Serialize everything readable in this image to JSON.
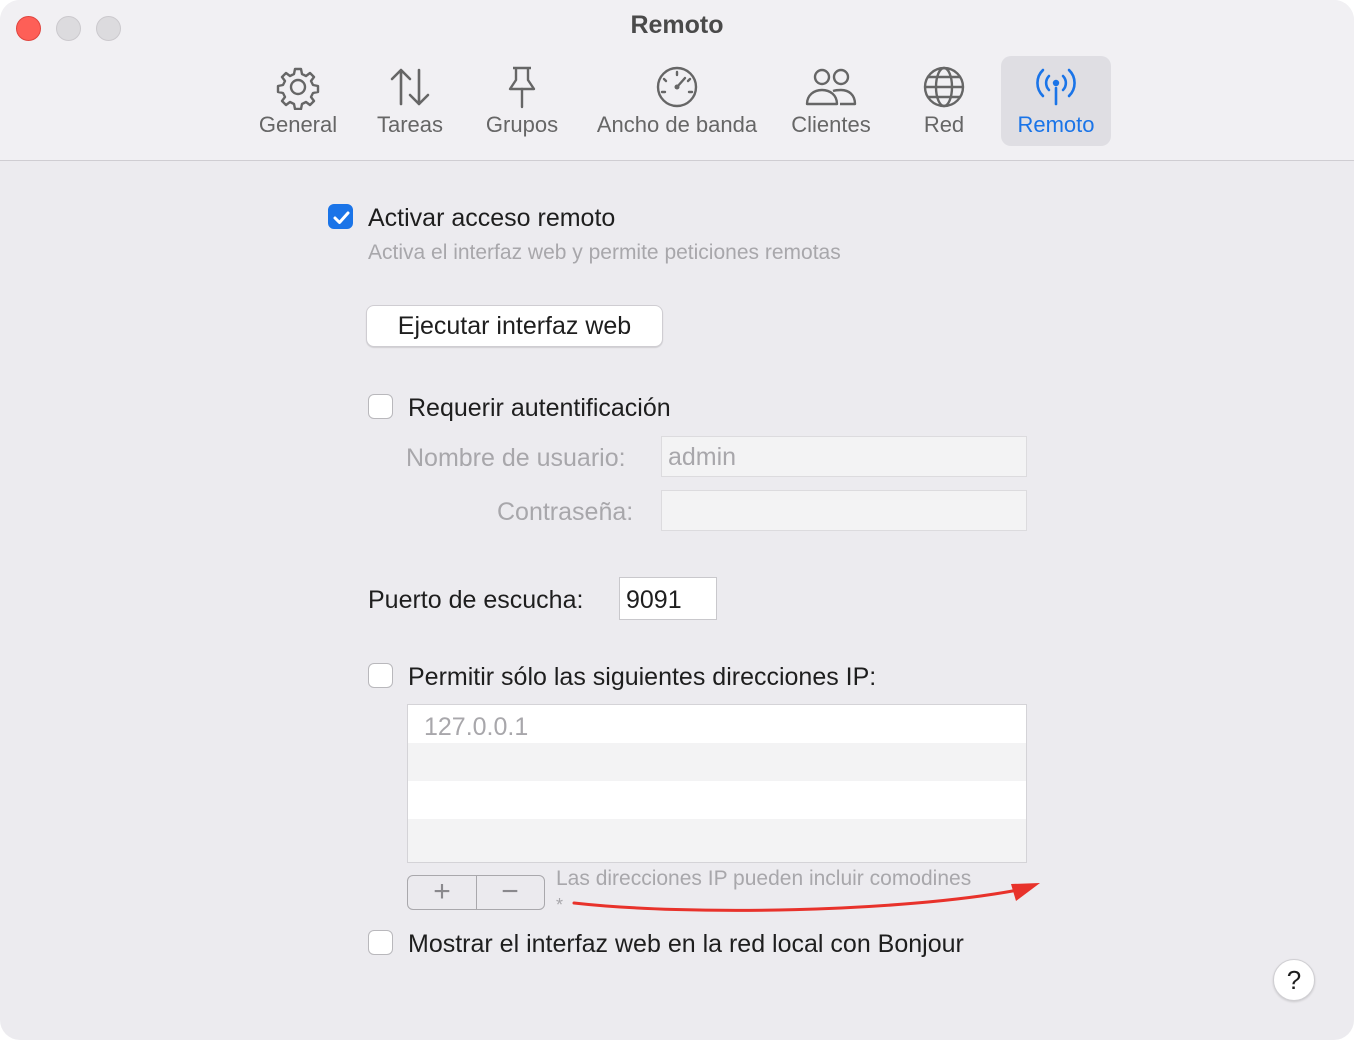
{
  "window": {
    "title": "Remoto"
  },
  "toolbar": {
    "tabs": [
      {
        "label": "General",
        "icon": "gear-icon"
      },
      {
        "label": "Tareas",
        "icon": "up-down-arrows-icon"
      },
      {
        "label": "Grupos",
        "icon": "pin-icon"
      },
      {
        "label": "Ancho de banda",
        "icon": "speedometer-icon"
      },
      {
        "label": "Clientes",
        "icon": "people-icon"
      },
      {
        "label": "Red",
        "icon": "globe-icon"
      },
      {
        "label": "Remoto",
        "icon": "antenna-icon",
        "selected": true
      }
    ]
  },
  "remote": {
    "enable_label": "Activar acceso remoto",
    "enable_checked": true,
    "enable_hint": "Activa el interfaz web y permite peticiones remotas",
    "launch_button": "Ejecutar interfaz web",
    "auth_label": "Requerir autentificación",
    "auth_checked": false,
    "username_label": "Nombre de usuario:",
    "username_value": "admin",
    "password_label": "Contraseña:",
    "password_value": "",
    "port_label": "Puerto de escucha:",
    "port_value": "9091",
    "ip_label": "Permitir sólo las siguientes direcciones IP:",
    "ip_checked": false,
    "ip_list": [
      "127.0.0.1"
    ],
    "add_symbol": "+",
    "remove_symbol": "−",
    "wildcard_hint": "Las direcciones IP pueden incluir comodines",
    "wildcard_symbol": "*",
    "bonjour_label": "Mostrar el interfaz web en la red local con Bonjour",
    "bonjour_checked": false,
    "help_symbol": "?"
  },
  "colors": {
    "accent": "#1a74e8",
    "close_button": "#fe5f57",
    "annotation_arrow": "#e8322b"
  }
}
